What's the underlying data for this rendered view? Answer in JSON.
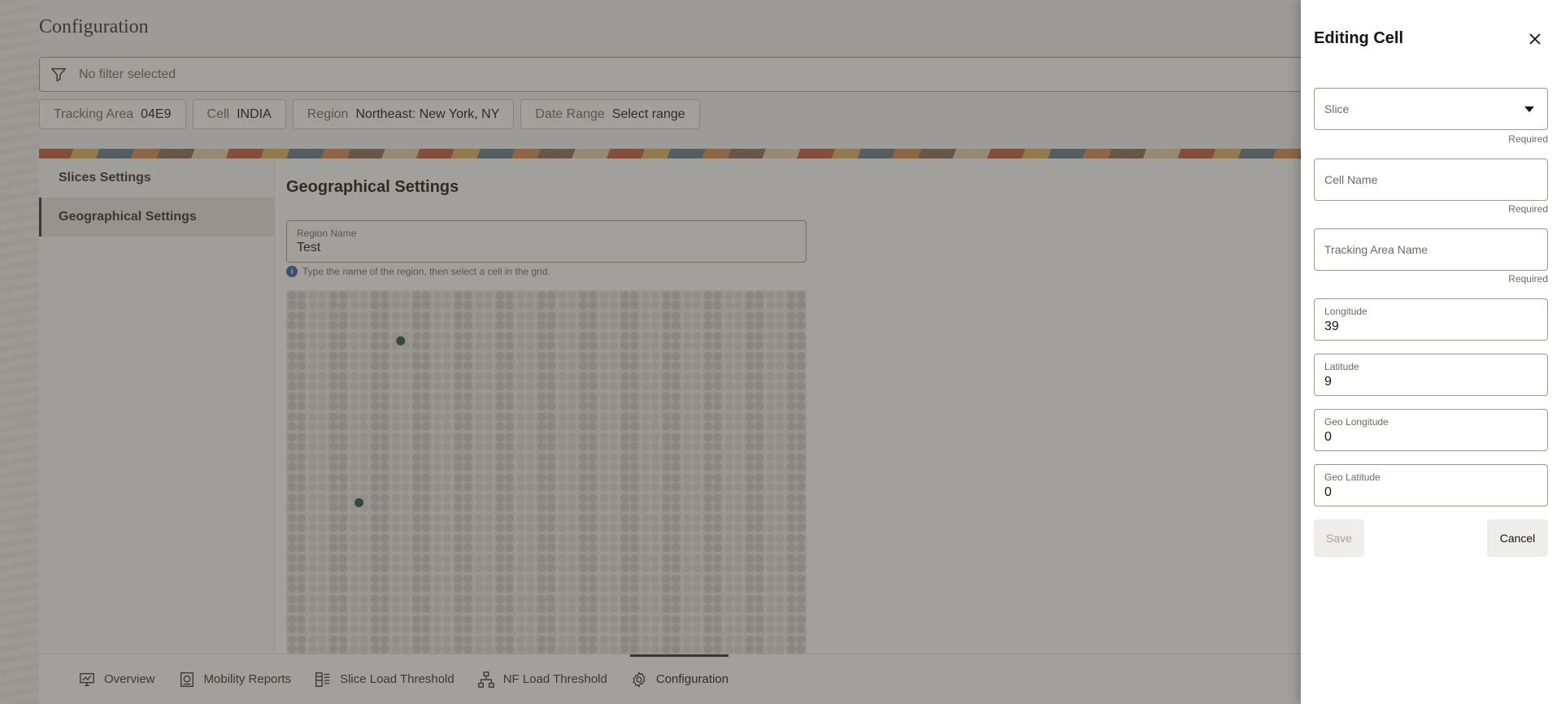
{
  "page": {
    "title": "Configuration"
  },
  "filter": {
    "placeholder": "No filter selected",
    "icon": "filter-icon"
  },
  "chips": [
    {
      "key": "Tracking Area",
      "value": "04E9"
    },
    {
      "key": "Cell",
      "value": "INDIA"
    },
    {
      "key": "Region",
      "value": "Northeast: New York, NY"
    },
    {
      "key": "Date Range",
      "value": "Select range"
    }
  ],
  "sidebar": {
    "items": [
      {
        "label": "Slices Settings",
        "active": false
      },
      {
        "label": "Geographical Settings",
        "active": true
      }
    ]
  },
  "main": {
    "title": "Geographical Settings",
    "region_field": {
      "label": "Region Name",
      "value": "Test"
    },
    "hint": "Type the name of the region, then select a cell in the grid.",
    "grid": {
      "columns": 25,
      "rows": 18,
      "selected_cells": [
        [
          5,
          2
        ],
        [
          3,
          10
        ]
      ]
    }
  },
  "bottom_nav": {
    "tabs": [
      {
        "label": "Overview",
        "icon": "monitor-chart-icon",
        "active": false
      },
      {
        "label": "Mobility Reports",
        "icon": "report-icon",
        "active": false
      },
      {
        "label": "Slice Load Threshold",
        "icon": "columns-icon",
        "active": false
      },
      {
        "label": "NF Load Threshold",
        "icon": "network-icon",
        "active": false
      },
      {
        "label": "Configuration",
        "icon": "gear-icon",
        "active": true
      }
    ]
  },
  "drawer": {
    "title": "Editing Cell",
    "fields": {
      "slice": {
        "placeholder": "Slice",
        "required_text": "Required"
      },
      "cell_name": {
        "placeholder": "Cell Name",
        "required_text": "Required"
      },
      "tracking_area_name": {
        "placeholder": "Tracking Area Name",
        "required_text": "Required"
      },
      "longitude": {
        "label": "Longitude",
        "value": "39"
      },
      "latitude": {
        "label": "Latitude",
        "value": "9"
      },
      "geo_longitude": {
        "label": "Geo Longitude",
        "value": "0"
      },
      "geo_latitude": {
        "label": "Geo Latitude",
        "value": "0"
      }
    },
    "save_label": "Save",
    "cancel_label": "Cancel"
  }
}
